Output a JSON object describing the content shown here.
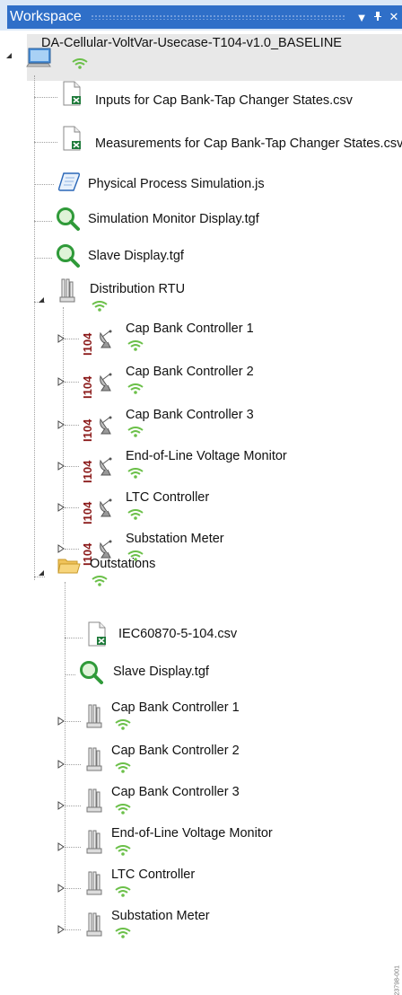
{
  "panel": {
    "title": "Workspace",
    "controls": {
      "dropdown": "▼",
      "pin": "ᚹ",
      "close": "✕"
    }
  },
  "tree": {
    "root": "DA-Cellular-VoltVar-Usecase-T104-v1.0_BASELINE",
    "files": [
      {
        "label": "Inputs for Cap Bank-Tap Changer States.csv",
        "icon": "csv-file-icon"
      },
      {
        "label": "Measurements for Cap Bank-Tap Changer States.csv",
        "icon": "csv-file-icon"
      },
      {
        "label": "Physical Process Simulation.js",
        "icon": "script-file-icon"
      },
      {
        "label": "Simulation Monitor Display.tgf",
        "icon": "display-file-icon"
      },
      {
        "label": "Slave Display.tgf",
        "icon": "display-file-icon"
      }
    ],
    "rtu": {
      "label": "Distribution RTU",
      "protocol_tag": "I104",
      "children": [
        "Cap Bank Controller 1",
        "Cap Bank Controller 2",
        "Cap Bank Controller 3",
        "End-of-Line Voltage Monitor",
        "LTC Controller",
        "Substation Meter"
      ]
    },
    "outstations": {
      "label": "Outstations",
      "files": [
        {
          "label": "IEC60870-5-104.csv",
          "icon": "csv-file-icon"
        },
        {
          "label": "Slave Display.tgf",
          "icon": "display-file-icon"
        }
      ],
      "children": [
        "Cap Bank Controller 1",
        "Cap Bank Controller 2",
        "Cap Bank Controller 3",
        "End-of-Line Voltage Monitor",
        "LTC Controller",
        "Substation Meter"
      ]
    }
  },
  "watermark": "23798-001",
  "colors": {
    "titlebar": "#2f6fc8",
    "wifi": "#6cc04a",
    "tag": "#8b1a1a",
    "selection": "#e8e8e8"
  }
}
